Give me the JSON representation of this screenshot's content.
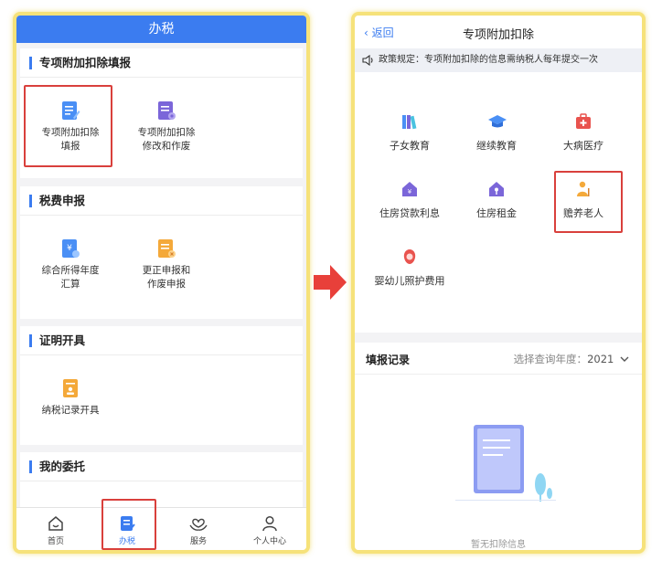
{
  "left_phone": {
    "header_title": "办税",
    "sections": [
      {
        "title": "专项附加扣除填报",
        "items": [
          "专项附加扣除\n填报",
          "专项附加扣除\n修改和作废"
        ]
      },
      {
        "title": "税费申报",
        "items": [
          "综合所得年度\n汇算",
          "更正申报和\n作废申报"
        ]
      },
      {
        "title": "证明开具",
        "items": [
          "纳税记录开具"
        ]
      },
      {
        "title": "我的委托",
        "items": []
      }
    ],
    "tabs": [
      "首页",
      "办税",
      "服务",
      "个人中心"
    ],
    "active_tab": "办税"
  },
  "right_phone": {
    "back_label": "返回",
    "title": "专项附加扣除",
    "notice": "政策规定：专项附加扣除的信息需纳税人每年提交一次",
    "items": [
      "子女教育",
      "继续教育",
      "大病医疗",
      "住房贷款利息",
      "住房租金",
      "赡养老人",
      "婴幼儿照护费用"
    ],
    "records_title": "填报记录",
    "year_label": "选择查询年度：",
    "year_value": "2021",
    "empty_text": "暂无扣除信息"
  },
  "colors": {
    "accent_blue": "#3b7cf0",
    "highlight_red": "#d9403c",
    "phone_frame": "#f6e27a",
    "arrow_red": "#e8403a"
  },
  "icons": [
    "pencil-document-icon",
    "edit-document-icon",
    "yuan-document-icon",
    "correction-document-icon",
    "certificate-icon",
    "home-icon",
    "tax-document-icon",
    "heart-hands-icon",
    "person-icon",
    "speaker-icon",
    "books-icon",
    "graduation-cap-icon",
    "medical-kit-icon",
    "house-icon",
    "house-key-icon",
    "elderly-person-icon",
    "baby-icon",
    "chevron-down-icon",
    "right-arrow-icon"
  ]
}
